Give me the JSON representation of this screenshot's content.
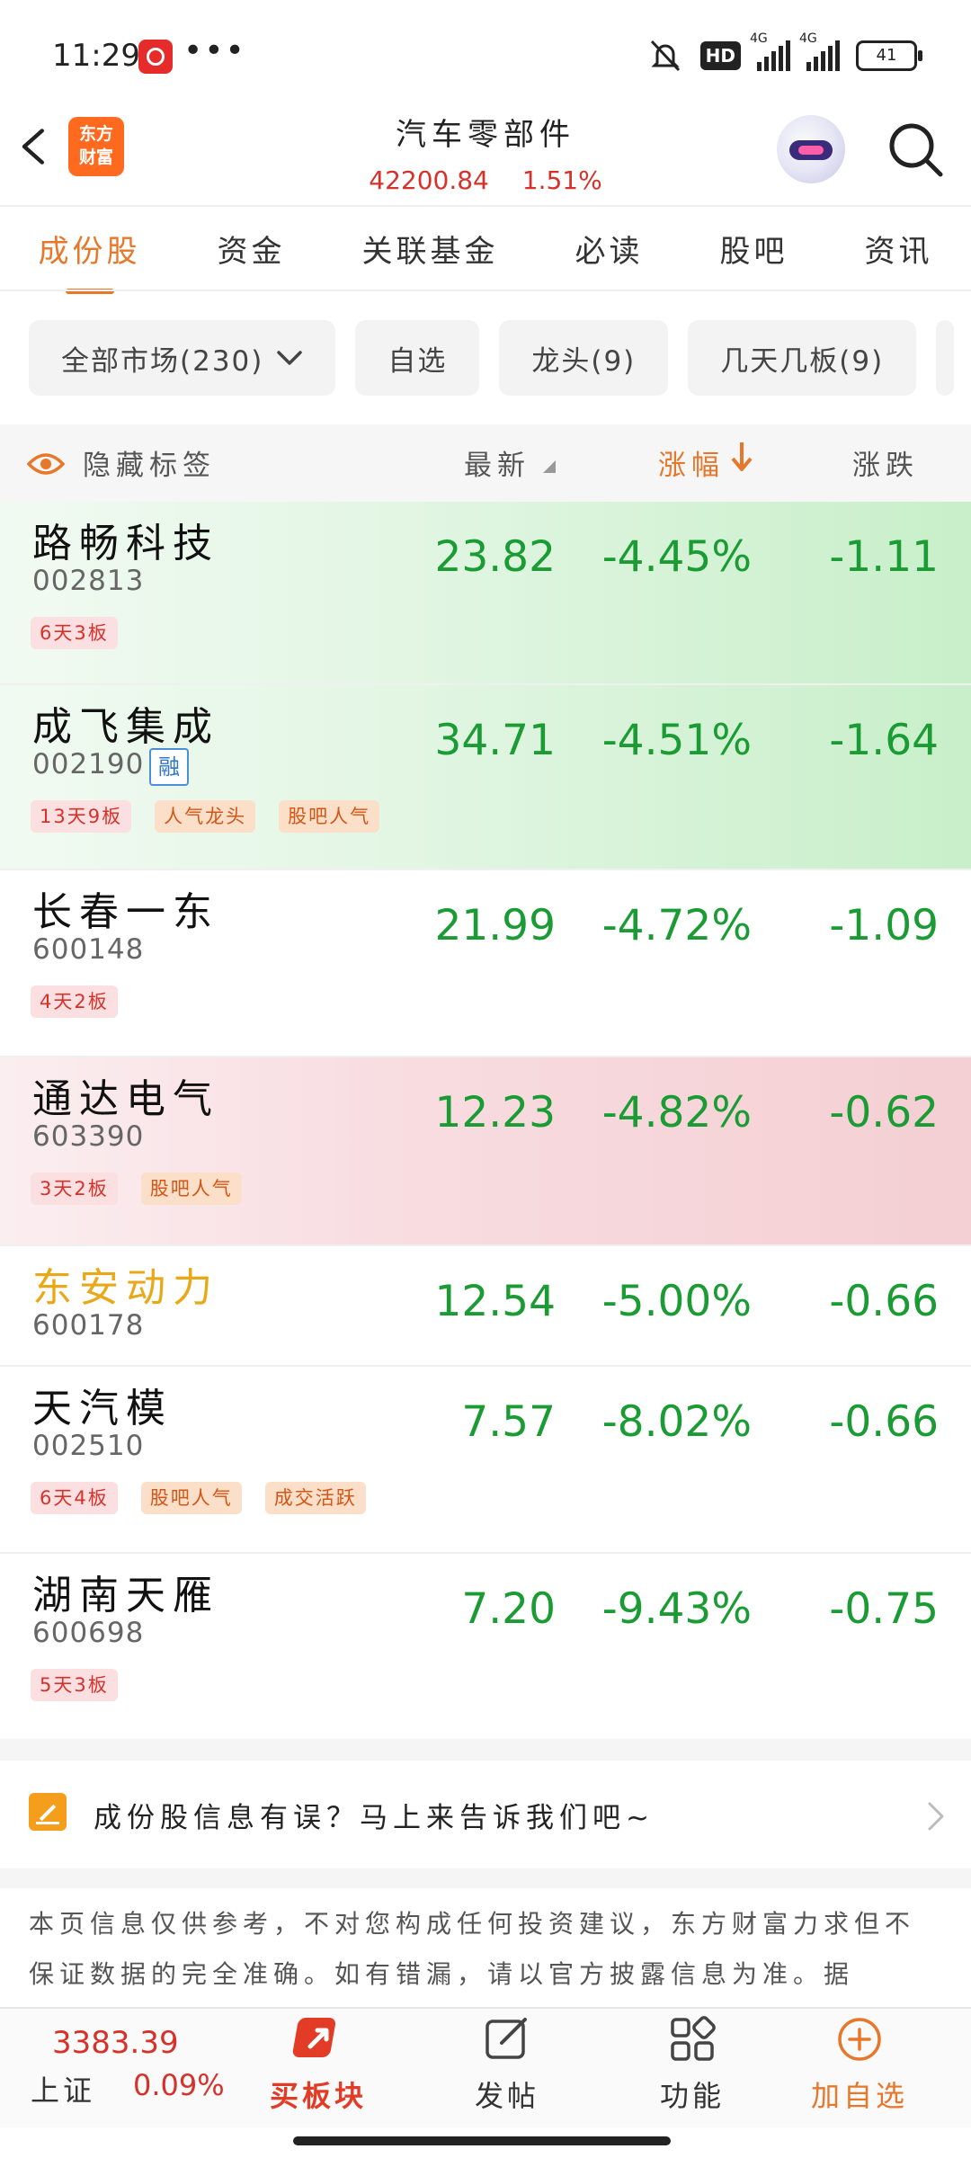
{
  "status_bar": {
    "time": "11:29",
    "more": "•••",
    "hd_label": "HD",
    "network1": "4G",
    "network2": "4G",
    "battery": "41"
  },
  "header": {
    "logo_line1": "东方",
    "logo_line2": "财富",
    "title": "汽车零部件",
    "index_value": "42200.84",
    "index_change": "1.51%"
  },
  "tabs": [
    {
      "label": "成份股",
      "active": true
    },
    {
      "label": "资金"
    },
    {
      "label": "关联基金"
    },
    {
      "label": "必读"
    },
    {
      "label": "股吧"
    },
    {
      "label": "资讯"
    }
  ],
  "chips": {
    "all_market": "全部市场(230)",
    "watchlist": "自选",
    "leaders": "龙头(9)",
    "boards": "几天几板(9)"
  },
  "table_header": {
    "hide_tags": "隐藏标签",
    "latest": "最新",
    "pct": "涨幅",
    "change": "涨跌"
  },
  "stocks": [
    {
      "name": "路畅科技",
      "code": "002813",
      "latest": "23.82",
      "pct": "-4.45%",
      "chg": "-1.11",
      "tags": [
        "6天3板"
      ]
    },
    {
      "name": "成飞集成",
      "code": "002190",
      "badge": "融",
      "latest": "34.71",
      "pct": "-4.51%",
      "chg": "-1.64",
      "tags": [
        "13天9板",
        "人气龙头",
        "股吧人气"
      ]
    },
    {
      "name": "长春一东",
      "code": "600148",
      "latest": "21.99",
      "pct": "-4.72%",
      "chg": "-1.09",
      "tags": [
        "4天2板"
      ]
    },
    {
      "name": "通达电气",
      "code": "603390",
      "latest": "12.23",
      "pct": "-4.82%",
      "chg": "-0.62",
      "tags": [
        "3天2板",
        "股吧人气"
      ]
    },
    {
      "name": "东安动力",
      "code": "600178",
      "latest": "12.54",
      "pct": "-5.00%",
      "chg": "-0.66",
      "tags": []
    },
    {
      "name": "天汽模",
      "code": "002510",
      "latest": "7.57",
      "pct": "-8.02%",
      "chg": "-0.66",
      "tags": [
        "6天4板",
        "股吧人气",
        "成交活跃"
      ]
    },
    {
      "name": "湖南天雁",
      "code": "600698",
      "latest": "7.20",
      "pct": "-9.43%",
      "chg": "-0.75",
      "tags": [
        "5天3板"
      ]
    }
  ],
  "feedback": {
    "text": "成份股信息有误？马上来告诉我们吧~"
  },
  "disclaimer": {
    "text": "本页信息仅供参考，不对您构成任何投资建议，东方财富力求但不保证数据的完全准确。如有错漏，请以官方披露信息为准。据"
  },
  "bottom_nav": {
    "index_value": "3383.39",
    "index_name": "上证",
    "index_pct": "0.09%",
    "buy_block": "买板块",
    "post": "发帖",
    "functions": "功能",
    "add_watch": "加自选"
  },
  "colors": {
    "accent": "#e7772a",
    "down_green": "#1a9b33",
    "up_red": "#d6322a"
  }
}
